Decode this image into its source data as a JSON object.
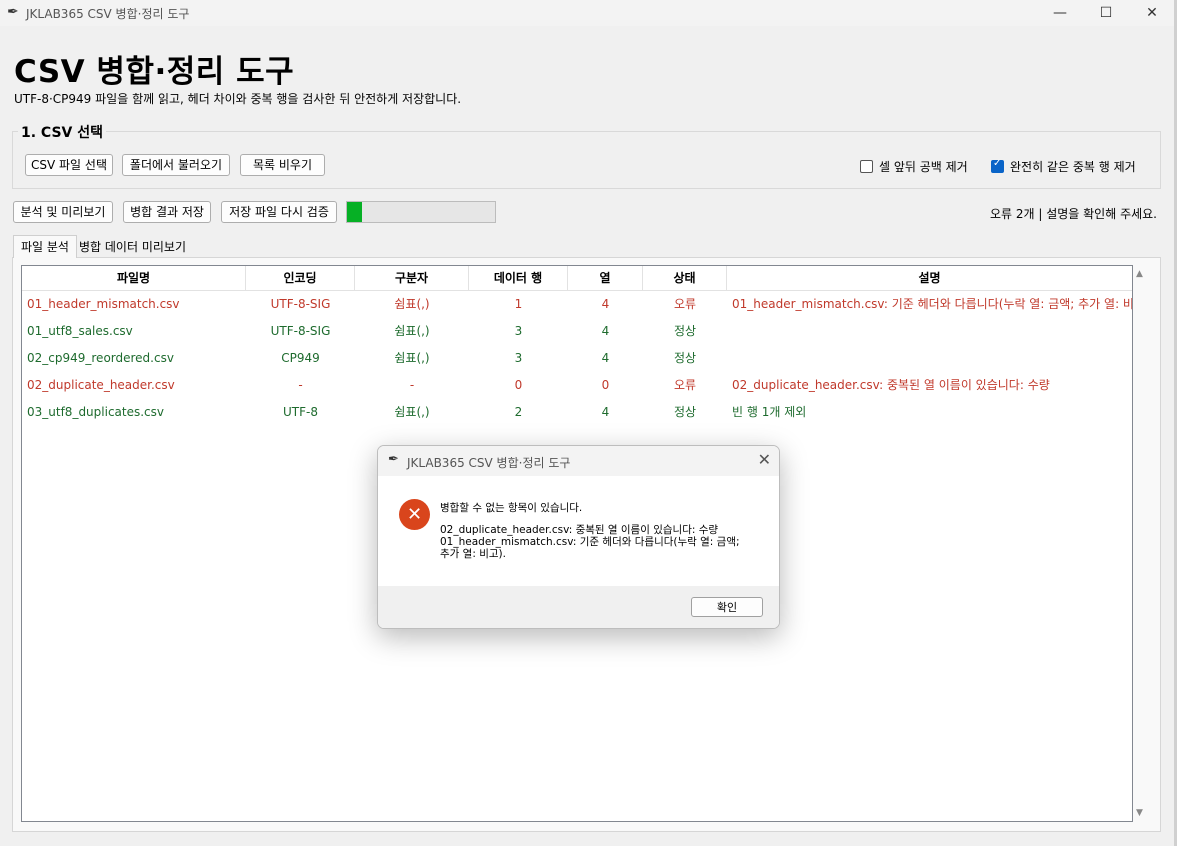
{
  "window": {
    "title": "JKLAB365 CSV 병합·정리 도구",
    "icon": "feather-icon"
  },
  "header": {
    "title": "CSV 병합·정리 도구",
    "subtitle": "UTF-8·CP949 파일을 함께 읽고, 헤더 차이와 중복 행을 검사한 뒤 안전하게 저장합니다."
  },
  "select_section": {
    "title": "1. CSV 선택",
    "buttons": {
      "select_files": "CSV 파일 선택",
      "load_folder": "폴더에서 불러오기",
      "clear_list": "목록 비우기"
    },
    "options": {
      "trim_spaces": {
        "label": "셀 앞뒤 공백 제거",
        "checked": false
      },
      "remove_duplicates": {
        "label": "완전히 같은 중복 행 제거",
        "checked": true
      }
    }
  },
  "actions": {
    "analyze": "분석 및 미리보기",
    "save_merged": "병합 결과 저장",
    "reverify": "저장 파일 다시 검증",
    "progress_fraction": 0.1,
    "status": "오류 2개 | 설명을 확인해 주세요."
  },
  "tabs": {
    "file_analysis": "파일 분석",
    "merged_preview": "병합 데이터 미리보기"
  },
  "table": {
    "columns": [
      "파일명",
      "인코딩",
      "구분자",
      "데이터 행",
      "열",
      "상태",
      "설명"
    ],
    "rows": [
      {
        "status_type": "error",
        "cells": [
          "01_header_mismatch.csv",
          "UTF-8-SIG",
          "쉼표(,)",
          "1",
          "4",
          "오류",
          "01_header_mismatch.csv: 기준 헤더와 다릅니다(누락 열: 금액; 추가 열: 비"
        ]
      },
      {
        "status_type": "ok",
        "cells": [
          "01_utf8_sales.csv",
          "UTF-8-SIG",
          "쉼표(,)",
          "3",
          "4",
          "정상",
          ""
        ]
      },
      {
        "status_type": "ok",
        "cells": [
          "02_cp949_reordered.csv",
          "CP949",
          "쉼표(,)",
          "3",
          "4",
          "정상",
          ""
        ]
      },
      {
        "status_type": "error",
        "cells": [
          "02_duplicate_header.csv",
          "-",
          "-",
          "0",
          "0",
          "오류",
          "02_duplicate_header.csv: 중복된 열 이름이 있습니다: 수량"
        ]
      },
      {
        "status_type": "ok",
        "cells": [
          "03_utf8_duplicates.csv",
          "UTF-8",
          "쉼표(,)",
          "2",
          "4",
          "정상",
          "빈 행 1개 제외"
        ]
      }
    ]
  },
  "dialog": {
    "title": "JKLAB365 CSV 병합·정리 도구",
    "icon": "error-icon",
    "message": "병합할 수 없는 항목이 있습니다.",
    "detail": "02_duplicate_header.csv: 중복된 열 이름이 있습니다: 수량\n01_header_mismatch.csv: 기준 헤더와 다릅니다(누락 열: 금액;\n추가 열: 비고).",
    "ok_label": "확인"
  },
  "colors": {
    "error": "#c0392b",
    "ok": "#1e6b2e",
    "progress": "#06b025",
    "accent": "#0a64c8"
  }
}
